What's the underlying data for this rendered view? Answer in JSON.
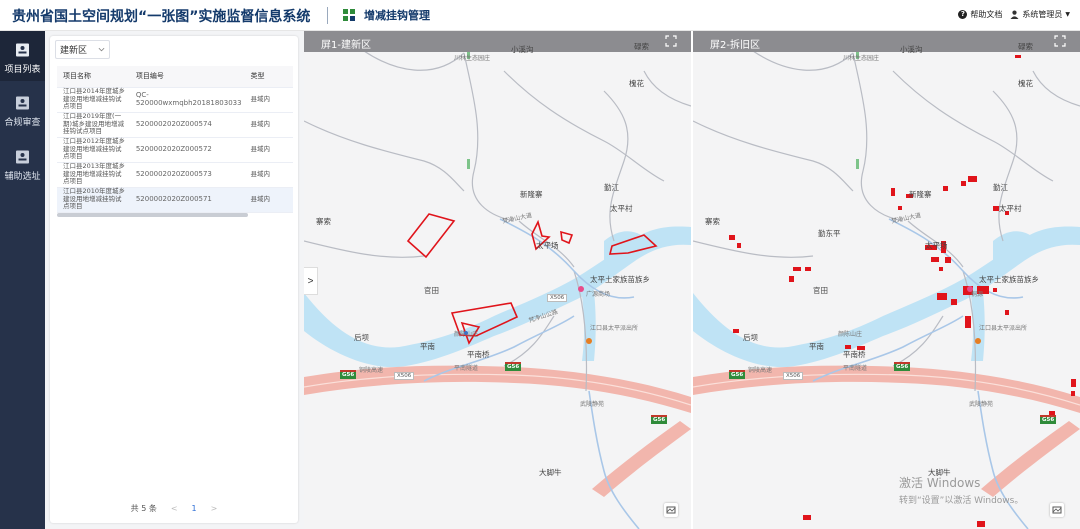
{
  "header": {
    "title": "贵州省国土空间规划“一张图”实施监督信息系统",
    "module_label": "增减挂钩管理",
    "help_label": "帮助文档",
    "user_label": "系统管理员"
  },
  "sidebar": {
    "items": [
      {
        "label": "项目列表",
        "icon": "document-icon",
        "active": true
      },
      {
        "label": "合规审查",
        "icon": "document-icon",
        "active": false
      },
      {
        "label": "辅助选址",
        "icon": "document-icon",
        "active": false
      }
    ]
  },
  "panel": {
    "select_value": "建新区",
    "columns": [
      "项目名称",
      "项目编号",
      "类型"
    ],
    "rows": [
      {
        "name": "江口县2014年度城乡建设用地增减挂钩试点项目",
        "code": "QC-520000wxmqbh20181803033",
        "type": "县域内"
      },
      {
        "name": "江口县2019年度(一期)城乡建设用地增减挂钩试点项目",
        "code": "5200002020Z000574",
        "type": "县域内"
      },
      {
        "name": "江口县2012年度城乡建设用地增减挂钩试点项目",
        "code": "5200002020Z000572",
        "type": "县域内"
      },
      {
        "name": "江口县2013年度城乡建设用地增减挂钩试点项目",
        "code": "5200002020Z000573",
        "type": "县域内"
      },
      {
        "name": "江口县2010年度城乡建设用地增减挂钩试点项目",
        "code": "5200002020Z000571",
        "type": "县域内"
      }
    ],
    "total_label": "共 5 条",
    "page": "1"
  },
  "maps": [
    {
      "title": "屏1-建新区"
    },
    {
      "title": "屏2-拆旧区"
    }
  ],
  "map_labels": {
    "xiaoxigou": "小溪沟",
    "chuanshen": "川林生态园庄",
    "luosuo": "碌索",
    "huaihua": "槐花",
    "xinlongzhai": "新隆寨",
    "qinjiang": "勤江",
    "taipingcun": "太平村",
    "zhaisuo": "寨索",
    "taipingchang": "太平场",
    "taipingshang": "太平土家族苗族乡",
    "guangyuanshang": "广源商场",
    "guantian": "官田",
    "jiangkou": "江口县太平派出所",
    "houba": "后坝",
    "pingnan": "平南",
    "pingnanqiao": "平南桥",
    "chenkeshan": "颜陈山庄",
    "wuling": "武陵静苑",
    "dajiaoniu": "大脚牛",
    "qindongping": "勤东平",
    "wuyuan": "桐源",
    "x506": "X506",
    "g56": "G56",
    "g56b": "G56",
    "road_fanjing": "梵净山大道",
    "road_tongren": "铜陵高速",
    "road_pingnan": "平南隧道",
    "road_fanjing2": "梵净山公路"
  },
  "watermark": {
    "line1": "激活 Windows",
    "line2": "转到“设置”以激活 Windows。"
  },
  "colors": {
    "header_title": "#143a6b",
    "sidebar_bg": "#26324a",
    "map_header": "#8c8c90",
    "river": "#bfe3f5",
    "highway": "#f2b6ad",
    "plot_stroke": "#e0141b",
    "link_blue": "#2f6fd6"
  }
}
